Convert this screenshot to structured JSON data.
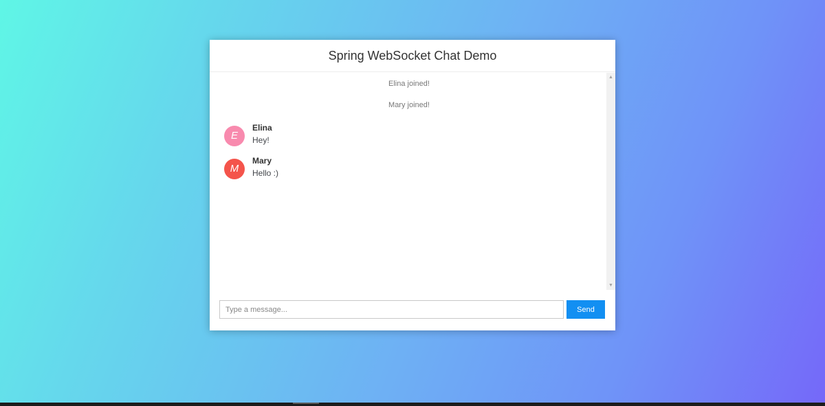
{
  "header": {
    "title": "Spring WebSocket Chat Demo"
  },
  "messages": {
    "events": [
      {
        "text": "Elina joined!"
      },
      {
        "text": "Mary joined!"
      }
    ],
    "chats": [
      {
        "initial": "E",
        "sender": "Elina",
        "text": "Hey!",
        "avatar_color": "#f88aae"
      },
      {
        "initial": "M",
        "sender": "Mary",
        "text": "Hello :)",
        "avatar_color": "#f4544b"
      }
    ]
  },
  "composer": {
    "placeholder": "Type a message...",
    "value": "",
    "send_label": "Send"
  },
  "icons": {
    "scroll_up": "chevron-up-icon",
    "scroll_down": "chevron-down-icon"
  },
  "colors": {
    "send_button": "#128ff2",
    "background_start": "#5ff6e6",
    "background_end": "#7568f9"
  }
}
